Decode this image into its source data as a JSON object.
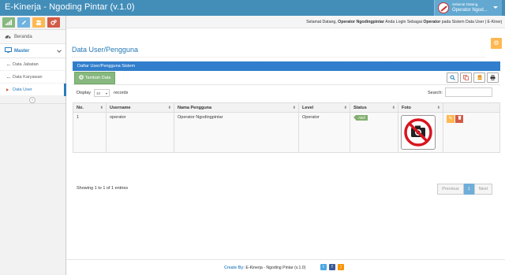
{
  "app": {
    "title": "E-Kinerja - Ngoding Pintar (v.1.0)"
  },
  "user_menu": {
    "welcome": "Selamat Datang,",
    "name": "Operator Ngod..."
  },
  "sidebar": {
    "shortcuts": [
      {
        "icon": "signal-icon",
        "color": "#87b87f"
      },
      {
        "icon": "pencil-icon",
        "color": "#6fb3e0"
      },
      {
        "icon": "users-icon",
        "color": "#ffb752"
      },
      {
        "icon": "cogs-icon",
        "color": "#d15b47"
      }
    ],
    "items": [
      {
        "label": "Beranda",
        "icon": "tachometer-icon"
      },
      {
        "label": "Master",
        "icon": "desktop-icon"
      }
    ],
    "submenu": [
      {
        "label": "Data Jabatan"
      },
      {
        "label": "Data Karyawan"
      },
      {
        "label": "Data User",
        "active": true
      }
    ]
  },
  "greeting": {
    "prefix": "Selamat Datang,",
    "name": "Operator Ngodingpintar",
    "middle": "Anda Login Sebagai",
    "role": "Operator",
    "suffix": "pada Sistem Data User | E-Kinerj"
  },
  "page": {
    "title": "Data User/Pengguna"
  },
  "panel": {
    "header": "Daftar User/Pengguna Sistem",
    "add_label": "Tambah Data",
    "tools": [
      "search-icon",
      "copy-icon",
      "database-icon",
      "print-icon"
    ]
  },
  "table_controls": {
    "display_label": "Display",
    "length_value": "10",
    "records_label": "records",
    "search_label": "Search:"
  },
  "table": {
    "columns": [
      "No.",
      "Username",
      "Nama Pengguna",
      "Level",
      "Status",
      "Foto",
      ""
    ],
    "rows": [
      {
        "no": "1",
        "username": "operator",
        "nama": "Operator Ngodingpintar",
        "level": "Operator",
        "status": "Aktif"
      }
    ]
  },
  "table_info": {
    "showing": "Showing 1 to 1 of 1 entries"
  },
  "pagination": {
    "previous": "Previous",
    "current": "1",
    "next": "Next"
  },
  "footer": {
    "credit_label": "Create By:",
    "credit_text": "E-Kinerja - Ngoding Pintar (v.1.0)"
  },
  "colors": {
    "topbar": "#438eb9",
    "primary": "#307ecc",
    "success": "#87b87f",
    "warning": "#ffb752",
    "danger": "#d15b47"
  }
}
